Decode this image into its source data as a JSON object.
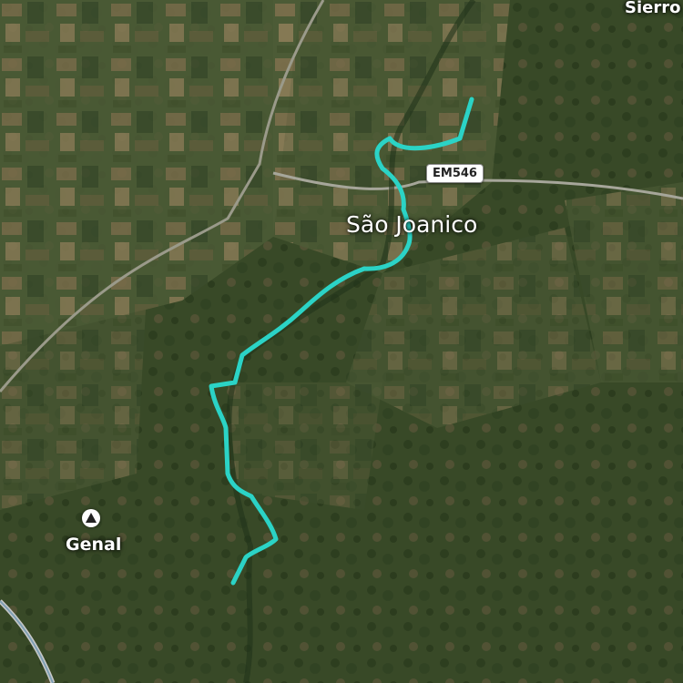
{
  "map": {
    "places": {
      "town": "São Joanico",
      "village": "Genal",
      "edge": "Sierro"
    },
    "road_ref": "EM546",
    "route_color": "#2bd3c6",
    "icons": {
      "peak": "mountain-peak-icon"
    }
  }
}
